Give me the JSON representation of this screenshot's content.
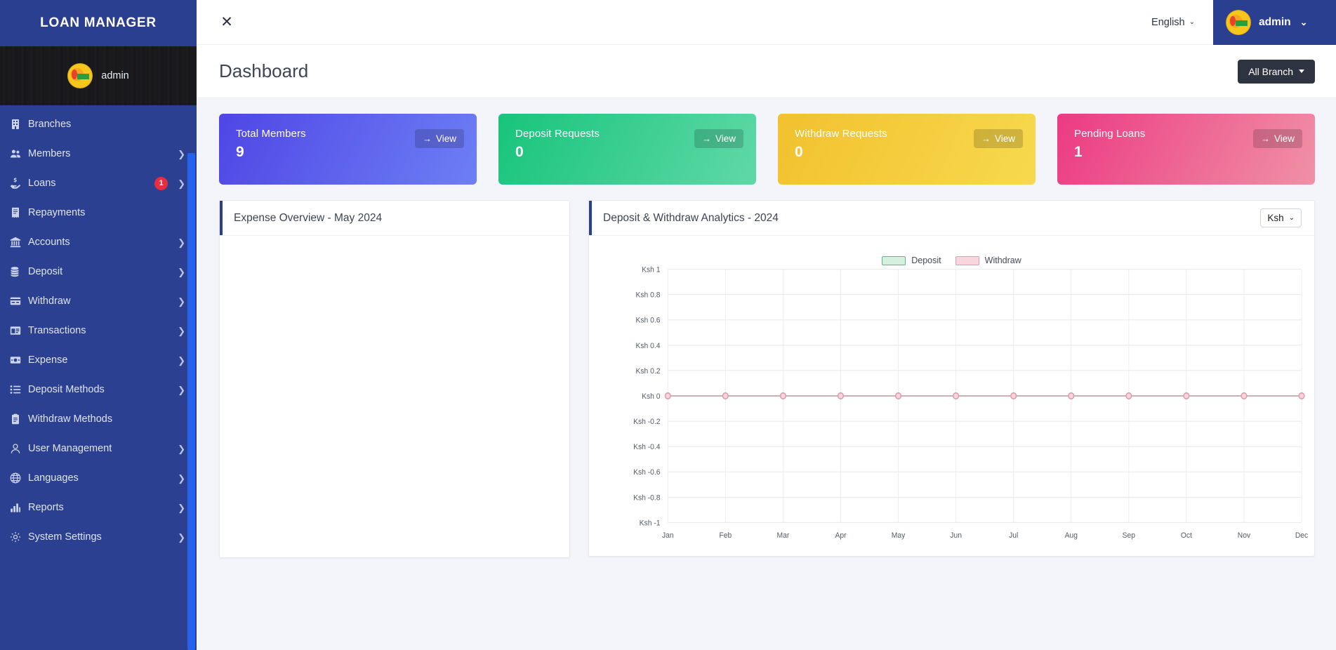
{
  "sidebar": {
    "brand": "LOAN MANAGER",
    "profile_name": "admin",
    "items": [
      {
        "label": "Branches",
        "icon": "building-icon",
        "chevron": false,
        "badge": null
      },
      {
        "label": "Members",
        "icon": "users-icon",
        "chevron": true,
        "badge": null
      },
      {
        "label": "Loans",
        "icon": "hand-money-icon",
        "chevron": true,
        "badge": "1"
      },
      {
        "label": "Repayments",
        "icon": "receipt-icon",
        "chevron": false,
        "badge": null
      },
      {
        "label": "Accounts",
        "icon": "bank-icon",
        "chevron": true,
        "badge": null
      },
      {
        "label": "Deposit",
        "icon": "coins-icon",
        "chevron": true,
        "badge": null
      },
      {
        "label": "Withdraw",
        "icon": "card-icon",
        "chevron": true,
        "badge": null
      },
      {
        "label": "Transactions",
        "icon": "window-icon",
        "chevron": true,
        "badge": null
      },
      {
        "label": "Expense",
        "icon": "money-bill-icon",
        "chevron": true,
        "badge": null
      },
      {
        "label": "Deposit Methods",
        "icon": "list-icon",
        "chevron": true,
        "badge": null
      },
      {
        "label": "Withdraw Methods",
        "icon": "clipboard-icon",
        "chevron": false,
        "badge": null
      },
      {
        "label": "User Management",
        "icon": "user-icon",
        "chevron": true,
        "badge": null
      },
      {
        "label": "Languages",
        "icon": "globe-icon",
        "chevron": true,
        "badge": null
      },
      {
        "label": "Reports",
        "icon": "bar-chart-icon",
        "chevron": true,
        "badge": null
      },
      {
        "label": "System Settings",
        "icon": "gear-icon",
        "chevron": true,
        "badge": null
      }
    ]
  },
  "topbar": {
    "menu_toggle_icon": "close-icon",
    "menu_toggle_glyph": "✕",
    "language": "English",
    "language_caret": "⌄",
    "user_name": "admin",
    "user_caret": "⌄"
  },
  "pagehead": {
    "title": "Dashboard",
    "branch_label": "All Branch"
  },
  "cards": [
    {
      "title": "Total Members",
      "value": "9",
      "view_label": "View",
      "color_from": "#4f46e5",
      "color_to": "#6d7ff5"
    },
    {
      "title": "Deposit Requests",
      "value": "0",
      "view_label": "View",
      "color_from": "#18c47c",
      "color_to": "#5fd9a6"
    },
    {
      "title": "Withdraw Requests",
      "value": "0",
      "view_label": "View",
      "color_from": "#f2c12e",
      "color_to": "#f7d94e"
    },
    {
      "title": "Pending Loans",
      "value": "1",
      "view_label": "View",
      "color_from": "#ec3a82",
      "color_to": "#f091a6"
    }
  ],
  "expense_panel": {
    "title": "Expense Overview - May 2024"
  },
  "analytics_panel": {
    "title": "Deposit & Withdraw Analytics - 2024",
    "currency_label": "Ksh",
    "currency_caret": "⌄"
  },
  "chart_data": {
    "type": "line",
    "title": "Deposit & Withdraw Analytics - 2024",
    "xlabel": "",
    "ylabel": "",
    "categories": [
      "Jan",
      "Feb",
      "Mar",
      "Apr",
      "May",
      "Jun",
      "Jul",
      "Aug",
      "Sep",
      "Oct",
      "Nov",
      "Dec"
    ],
    "ytick_labels": [
      "Ksh 1",
      "Ksh 0.8",
      "Ksh 0.6",
      "Ksh 0.4",
      "Ksh 0.2",
      "Ksh 0",
      "Ksh -0.2",
      "Ksh -0.4",
      "Ksh -0.6",
      "Ksh -0.8",
      "Ksh -1"
    ],
    "ytick_values": [
      1,
      0.8,
      0.6,
      0.4,
      0.2,
      0,
      -0.2,
      -0.4,
      -0.6,
      -0.8,
      -1
    ],
    "ylim": [
      -1,
      1
    ],
    "grid": true,
    "legend_position": "top-center",
    "series": [
      {
        "name": "Deposit",
        "values": [
          0,
          0,
          0,
          0,
          0,
          0,
          0,
          0,
          0,
          0,
          0,
          0
        ],
        "color": "#5cb98a",
        "fill": "#d6f0e0"
      },
      {
        "name": "Withdraw",
        "values": [
          0,
          0,
          0,
          0,
          0,
          0,
          0,
          0,
          0,
          0,
          0,
          0
        ],
        "color": "#e79aae",
        "fill": "#f9d6de"
      }
    ]
  }
}
